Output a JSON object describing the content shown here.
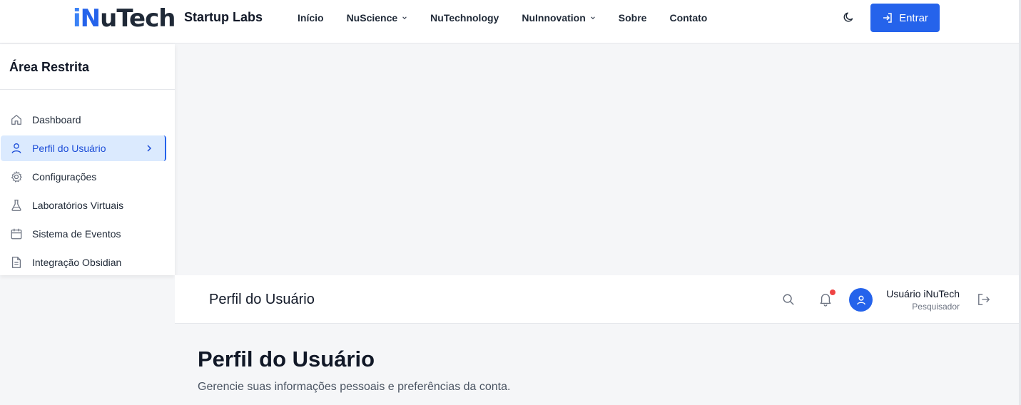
{
  "nav": {
    "logo_prefix": "i",
    "logo_n": "N",
    "logo_rest": "uTech",
    "brand": "Startup Labs",
    "links": [
      {
        "label": "Início"
      },
      {
        "label": "NuScience"
      },
      {
        "label": "NuTechnology"
      },
      {
        "label": "NuInnovation"
      },
      {
        "label": "Sobre"
      },
      {
        "label": "Contato"
      }
    ],
    "login_label": "Entrar"
  },
  "sidebar": {
    "title": "Área Restrita",
    "items": [
      {
        "label": "Dashboard",
        "icon": "home-icon"
      },
      {
        "label": "Perfil do Usuário",
        "icon": "user-icon",
        "active": true
      },
      {
        "label": "Configurações",
        "icon": "gear-icon"
      },
      {
        "label": "Laboratórios Virtuais",
        "icon": "flask-icon"
      },
      {
        "label": "Sistema de Eventos",
        "icon": "calendar-icon"
      },
      {
        "label": "Integração Obsidian",
        "icon": "document-icon"
      }
    ]
  },
  "header": {
    "title": "Perfil do Usuário",
    "user_name": "Usuário iNuTech",
    "user_role": "Pesquisador"
  },
  "main": {
    "title": "Perfil do Usuário",
    "subtitle": "Gerencie suas informações pessoais e preferências da conta."
  },
  "colors": {
    "accent": "#2563eb",
    "active_bg": "#dbeafe",
    "notification": "#ef4444"
  }
}
